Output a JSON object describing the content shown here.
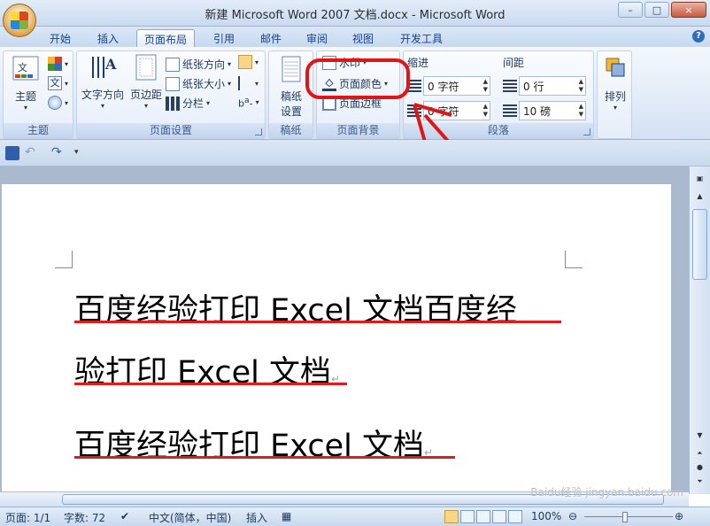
{
  "window": {
    "title": "新建 Microsoft Word 2007 文档.docx - Microsoft Word",
    "controls": [
      "–",
      "□",
      "×"
    ]
  },
  "tabs": [
    {
      "label": "开始",
      "active": false
    },
    {
      "label": "插入",
      "active": false
    },
    {
      "label": "页面布局",
      "active": true
    },
    {
      "label": "引用",
      "active": false
    },
    {
      "label": "邮件",
      "active": false
    },
    {
      "label": "审阅",
      "active": false
    },
    {
      "label": "视图",
      "active": false
    },
    {
      "label": "开发工具",
      "active": false
    }
  ],
  "ribbon": {
    "theme": {
      "group_label": "主题",
      "button": "主题"
    },
    "page_setup": {
      "group_label": "页面设置",
      "text_direction": "文字方向",
      "margins": "页边距",
      "orientation": "纸张方向",
      "size": "纸张大小",
      "columns": "分栏"
    },
    "draft": {
      "group_label": "稿纸",
      "button": "稿纸\n设置",
      "button_line1": "稿纸",
      "button_line2": "设置"
    },
    "background": {
      "group_label": "页面背景",
      "watermark": "水印",
      "page_color": "页面颜色",
      "page_borders": "页面边框"
    },
    "paragraph": {
      "group_label": "段落",
      "indent_label": "缩进",
      "spacing_label": "间距",
      "indent_left": "0 字符",
      "indent_right": "0 字符",
      "spacing_before": "0 行",
      "spacing_after": "10 磅"
    },
    "arrange": {
      "button": "排列"
    }
  },
  "document": {
    "lines": [
      "百度经验打印 Excel 文档百度经",
      "验打印 Excel 文档",
      "百度经验打印 Excel 文档"
    ],
    "paragraph_mark": "↵"
  },
  "statusbar": {
    "page": "页面: 1/1",
    "words": "字数: 72",
    "language": "中文(简体，中国)",
    "insert": "插入",
    "zoom": "100%"
  },
  "watermark_text": "Baidu经验 jingyan.baidu.com",
  "colors": {
    "annotation": "#e01616",
    "accent": "#15428b"
  }
}
